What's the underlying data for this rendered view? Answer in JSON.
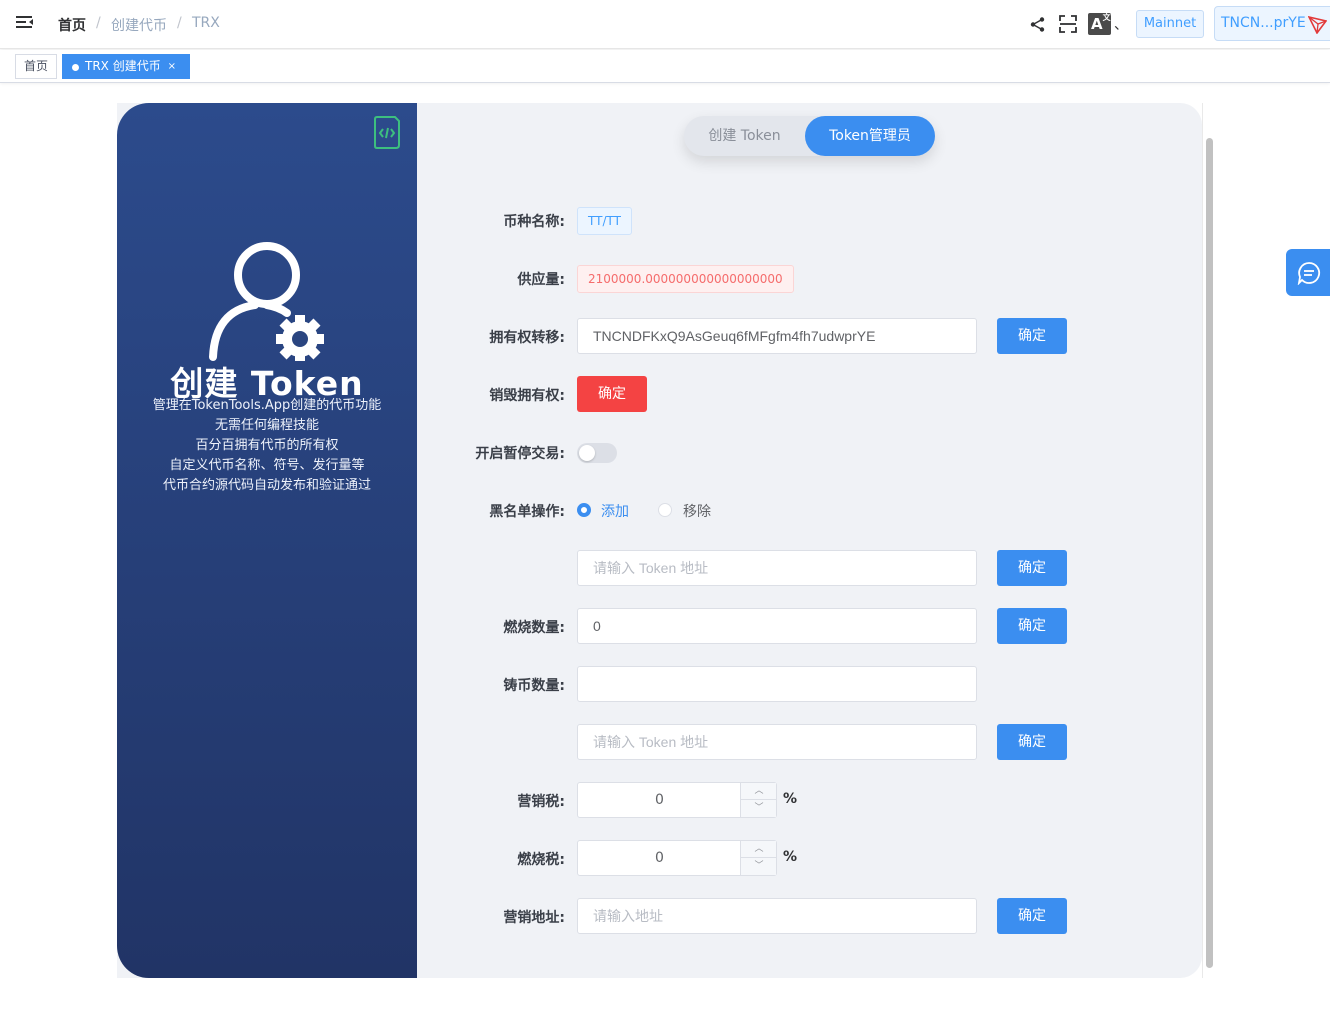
{
  "header": {
    "breadcrumb": [
      "首页",
      "创建代币",
      "TRX"
    ],
    "network_label": "Mainnet",
    "wallet_label": "TNCN...prYE",
    "lang_separator": "、"
  },
  "tags": {
    "home": "首页",
    "active": "TRX 创建代币",
    "close": "×"
  },
  "left_panel": {
    "title": "创建 Token",
    "lines": [
      "管理在TokenTools.App创建的代币功能",
      "无需任何编程技能",
      "百分百拥有代币的所有权",
      "自定义代币名称、符号、发行量等",
      "代币合约源代码自动发布和验证通过"
    ]
  },
  "tabs": {
    "create": "创建 Token",
    "admin": "Token管理员"
  },
  "form": {
    "token_name_label": "币种名称:",
    "token_name_value": "TT/TT",
    "supply_label": "供应量:",
    "supply_value": "2100000.000000000000000000",
    "transfer_label": "拥有权转移:",
    "transfer_value": "TNCNDFKxQ9AsGeuq6fMFgfm4fh7udwprYE",
    "renounce_label": "销毁拥有权:",
    "pause_label": "开启暂停交易:",
    "blacklist_label": "黑名单操作:",
    "blacklist_add": "添加",
    "blacklist_remove": "移除",
    "blacklist_placeholder": "请输入 Token 地址",
    "burn_label": "燃烧数量:",
    "burn_value": "0",
    "mint_label": "铸币数量:",
    "mint_value": "",
    "mint_placeholder": "请输入 Token 地址",
    "marketing_tax_label": "营销税:",
    "marketing_tax_value": "0",
    "burn_tax_label": "燃烧税:",
    "burn_tax_value": "0",
    "percent": "%",
    "marketing_addr_label": "营销地址:",
    "marketing_addr_placeholder": "请输入地址",
    "confirm": "确定"
  },
  "colors": {
    "accent": "#3b8ef0",
    "danger": "#f44343",
    "panel_top": "#2c4b8c",
    "panel_bottom": "#213466"
  }
}
